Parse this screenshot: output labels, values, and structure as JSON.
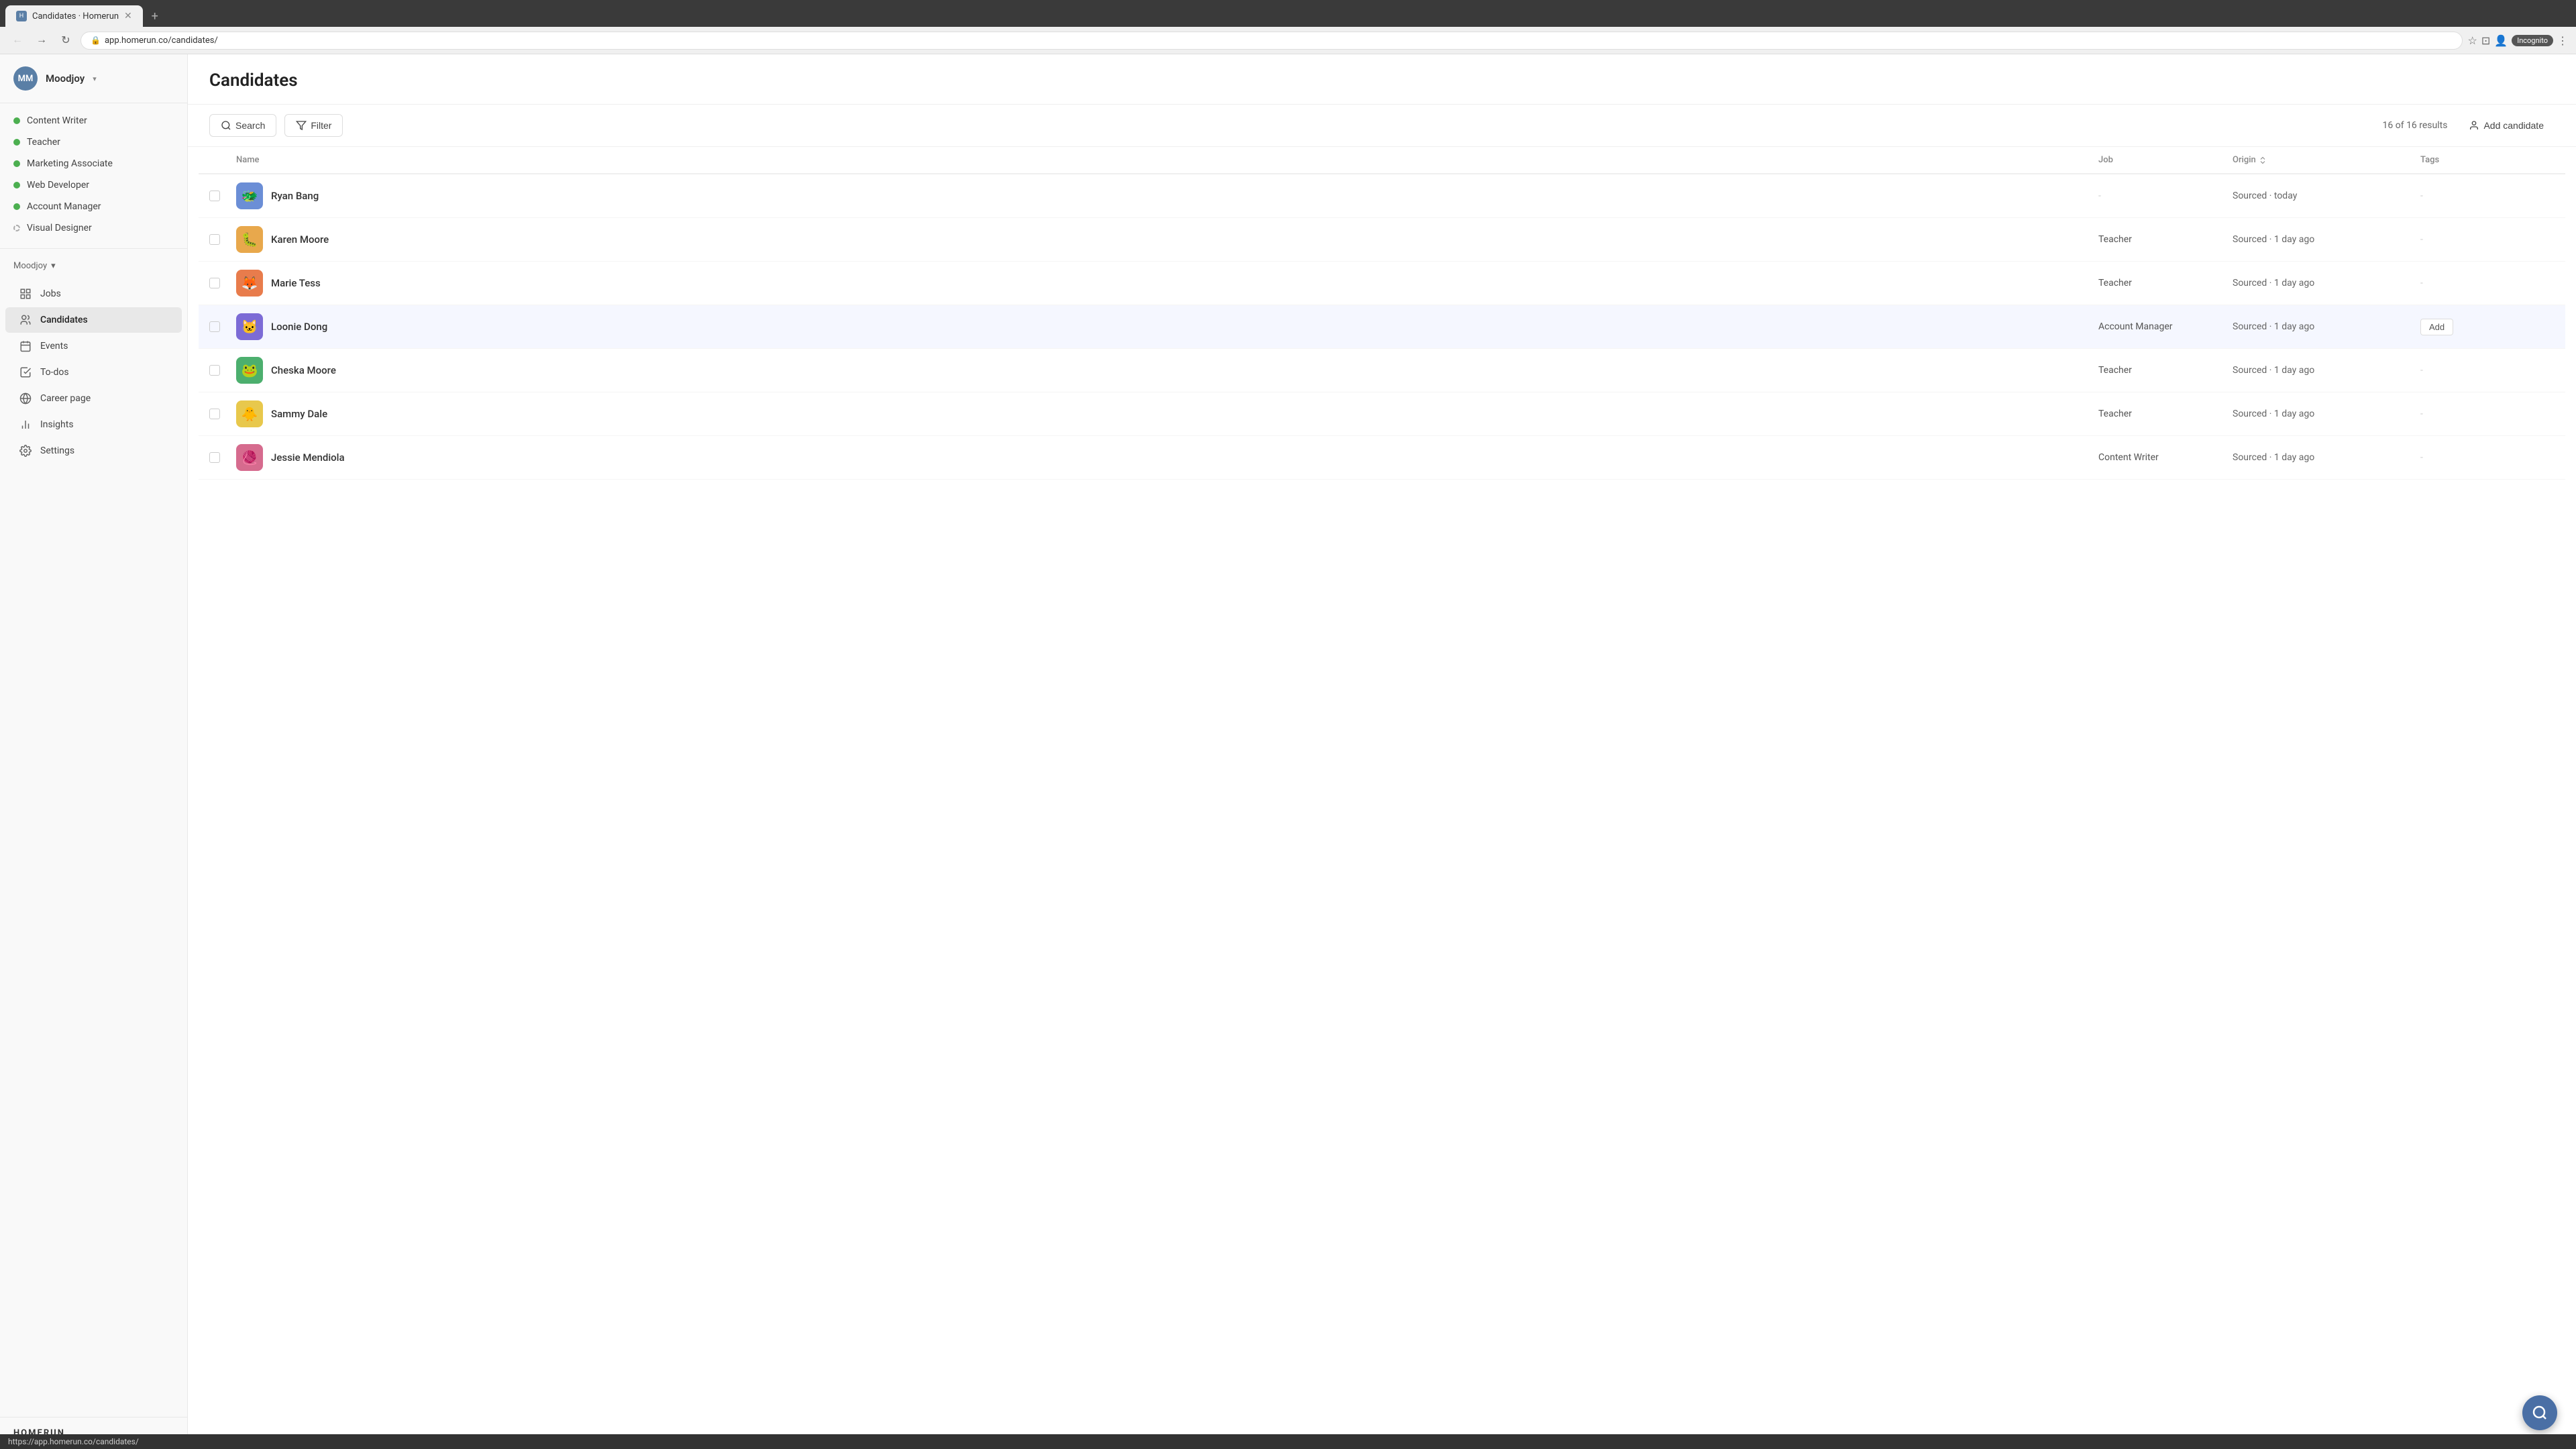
{
  "browser": {
    "tab_title": "Candidates · Homerun",
    "tab_new": "+",
    "address": "app.homerun.co/candidates/",
    "incognito_label": "Incognito",
    "status_bar_url": "https://app.homerun.co/candidates/"
  },
  "sidebar": {
    "avatar_initials": "MM",
    "company_name": "Moodjoy",
    "company_dropdown_arrow": "▾",
    "jobs": [
      {
        "label": "Content Writer",
        "dot": "green"
      },
      {
        "label": "Teacher",
        "dot": "green"
      },
      {
        "label": "Marketing Associate",
        "dot": "green"
      },
      {
        "label": "Web Developer",
        "dot": "green"
      },
      {
        "label": "Account Manager",
        "dot": "green"
      },
      {
        "label": "Visual Designer",
        "dot": "dashed"
      }
    ],
    "company_section_label": "Moodjoy",
    "nav_items": [
      {
        "id": "jobs",
        "label": "Jobs",
        "icon": "grid"
      },
      {
        "id": "candidates",
        "label": "Candidates",
        "icon": "people",
        "active": true
      },
      {
        "id": "events",
        "label": "Events",
        "icon": "calendar"
      },
      {
        "id": "todos",
        "label": "To-dos",
        "icon": "check"
      },
      {
        "id": "career",
        "label": "Career page",
        "icon": "globe"
      },
      {
        "id": "insights",
        "label": "Insights",
        "icon": "chart"
      },
      {
        "id": "settings",
        "label": "Settings",
        "icon": "gear"
      }
    ],
    "logo": "HOMERUN"
  },
  "main": {
    "page_title": "Candidates",
    "toolbar": {
      "search_label": "Search",
      "filter_label": "Filter",
      "results_count": "16 of 16 results",
      "add_candidate_label": "Add candidate"
    },
    "table": {
      "headers": [
        "",
        "Name",
        "Job",
        "Origin",
        "Tags"
      ],
      "rows": [
        {
          "id": 1,
          "name": "Ryan Bang",
          "avatar": "🐲",
          "avatar_color": "#6b8ed6",
          "job": "-",
          "origin": "Sourced · today",
          "tags": "-",
          "add_tag": false
        },
        {
          "id": 2,
          "name": "Karen Moore",
          "avatar": "🐛",
          "avatar_color": "#e8a84c",
          "job": "Teacher",
          "origin": "Sourced · 1 day ago",
          "tags": "-",
          "add_tag": false
        },
        {
          "id": 3,
          "name": "Marie Tess",
          "avatar": "🦊",
          "avatar_color": "#e87c4c",
          "job": "Teacher",
          "origin": "Sourced · 1 day ago",
          "tags": "-",
          "add_tag": false
        },
        {
          "id": 4,
          "name": "Loonie Dong",
          "avatar": "🐱",
          "avatar_color": "#7c6bd6",
          "job": "Account Manager",
          "origin": "Sourced · 1 day ago",
          "tags": "Add",
          "add_tag": true,
          "hovered": true
        },
        {
          "id": 5,
          "name": "Cheska Moore",
          "avatar": "🐸",
          "avatar_color": "#4caf6e",
          "job": "Teacher",
          "origin": "Sourced · 1 day ago",
          "tags": "-",
          "add_tag": false
        },
        {
          "id": 6,
          "name": "Sammy Dale",
          "avatar": "🐥",
          "avatar_color": "#e8c84c",
          "job": "Teacher",
          "origin": "Sourced · 1 day ago",
          "tags": "-",
          "add_tag": false
        },
        {
          "id": 7,
          "name": "Jessie Mendiola",
          "avatar": "🧶",
          "avatar_color": "#d66b8e",
          "job": "Content Writer",
          "origin": "Sourced · 1 day ago",
          "tags": "-",
          "add_tag": false
        }
      ]
    }
  },
  "fab": {
    "title": "Search"
  }
}
